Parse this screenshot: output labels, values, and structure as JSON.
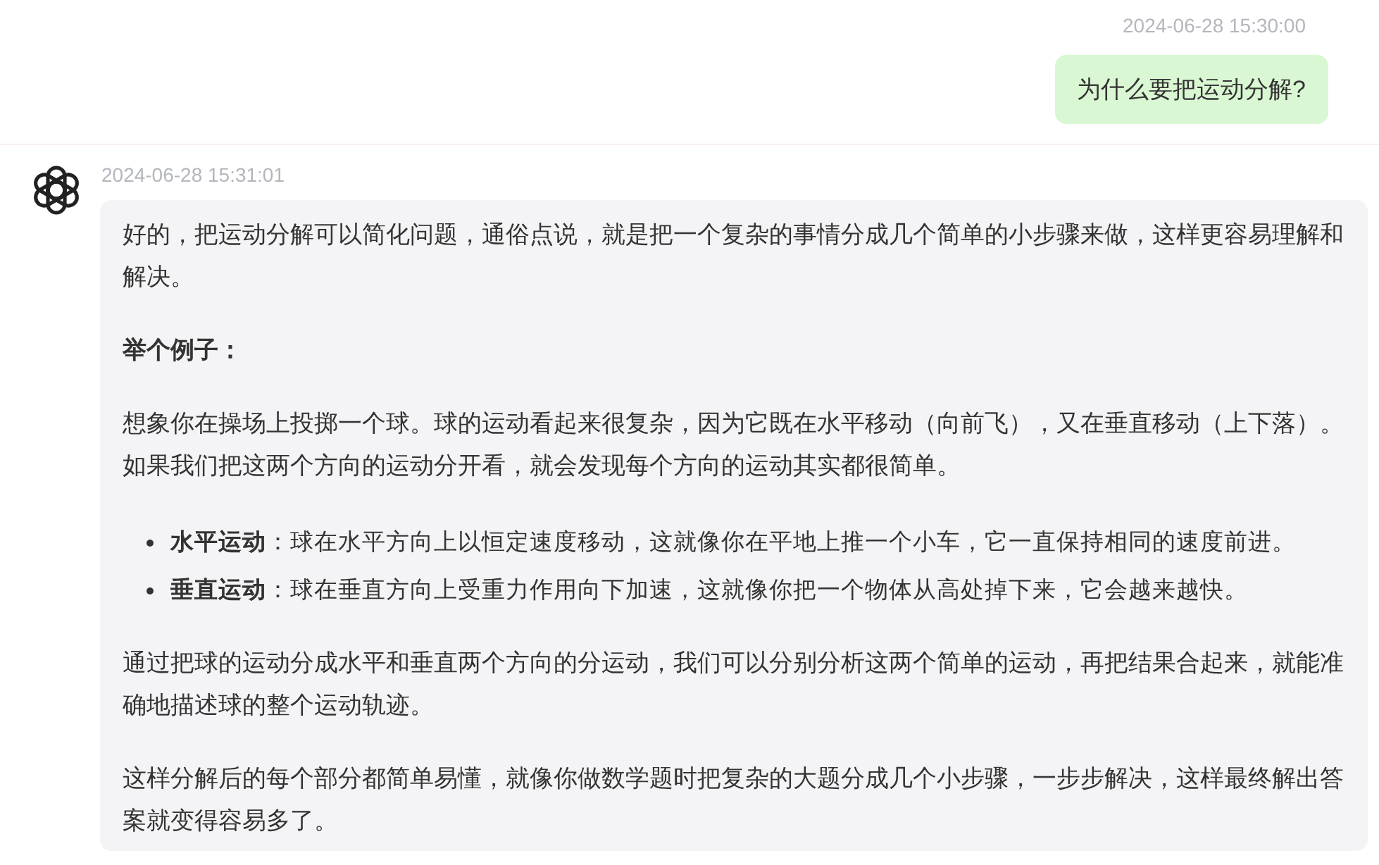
{
  "messages": [
    {
      "kind": "user",
      "time": "2024-06-28 15:30:00",
      "text": "为什么要把运动分解?"
    },
    {
      "kind": "assistant",
      "time": "2024-06-28 15:31:01",
      "blocks": [
        {
          "kind": "paragraph",
          "text": "好的，把运动分解可以简化问题，通俗点说，就是把一个复杂的事情分成几个简单的小步骤来做，这样更容易理解和解决。"
        },
        {
          "kind": "heading",
          "text": "举个例子："
        },
        {
          "kind": "paragraph",
          "text": "想象你在操场上投掷一个球。球的运动看起来很复杂，因为它既在水平移动（向前飞），又在垂直移动（上下落）。如果我们把这两个方向的运动分开看，就会发现每个方向的运动其实都很简单。"
        },
        {
          "kind": "list",
          "items": [
            "**水平运动**：球在水平方向上以恒定速度移动，这就像你在平地上推一个小车，它一直保持相同的速度前进。",
            "**垂直运动**：球在垂直方向上受重力作用向下加速，这就像你把一个物体从高处掉下来，它会越来越快。"
          ]
        },
        {
          "kind": "paragraph",
          "text": "通过把球的运动分成水平和垂直两个方向的分运动，我们可以分别分析这两个简单的运动，再把结果合起来，就能准确地描述球的整个运动轨迹。"
        },
        {
          "kind": "paragraph",
          "text": "这样分解后的每个部分都简单易懂，就像你做数学题时把复杂的大题分成几个小步骤，一步步解决，这样最终解出答案就变得容易多了。"
        }
      ]
    }
  ]
}
